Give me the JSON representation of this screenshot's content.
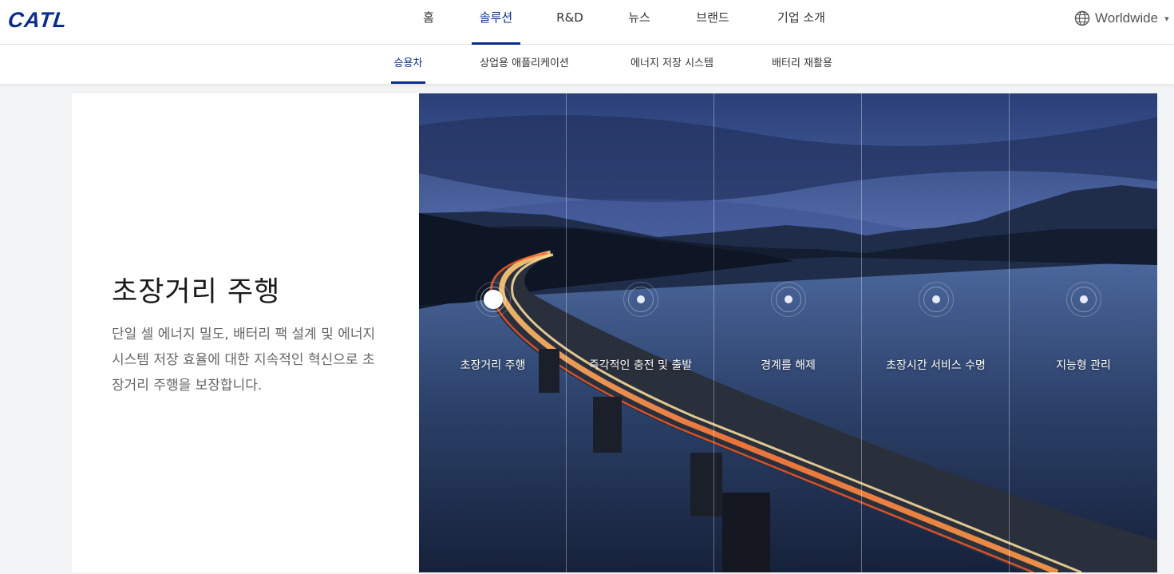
{
  "header": {
    "logo": "CATL",
    "nav": [
      {
        "label": "홈",
        "active": false
      },
      {
        "label": "솔루션",
        "active": true
      },
      {
        "label": "R&D",
        "active": false
      },
      {
        "label": "뉴스",
        "active": false
      },
      {
        "label": "브랜드",
        "active": false
      },
      {
        "label": "기업 소개",
        "active": false
      }
    ],
    "region": "Worldwide",
    "region_icon": "globe-icon"
  },
  "subnav": [
    {
      "label": "승용차",
      "active": true
    },
    {
      "label": "상업용 애플리케이션",
      "active": false
    },
    {
      "label": "에너지 저장 시스템",
      "active": false
    },
    {
      "label": "배터리 재활용",
      "active": false
    }
  ],
  "feature": {
    "title": "초장거리 주행",
    "description": "단일 셀 에너지 밀도, 배터리 팩 설계 및 에너지 시스템 저장 효율에 대한 지속적인 혁신으로 초장거리 주행을 보장합니다."
  },
  "hero": {
    "items": [
      {
        "label": "초장거리 주행",
        "active": true
      },
      {
        "label": "즉각적인 충전 및 출발",
        "active": false
      },
      {
        "label": "경계를 해제",
        "active": false
      },
      {
        "label": "초장시간 서비스 수명",
        "active": false
      },
      {
        "label": "지능형 관리",
        "active": false
      }
    ]
  },
  "colors": {
    "brand": "#0a2d8c",
    "text": "#222222",
    "muted": "#666666"
  }
}
